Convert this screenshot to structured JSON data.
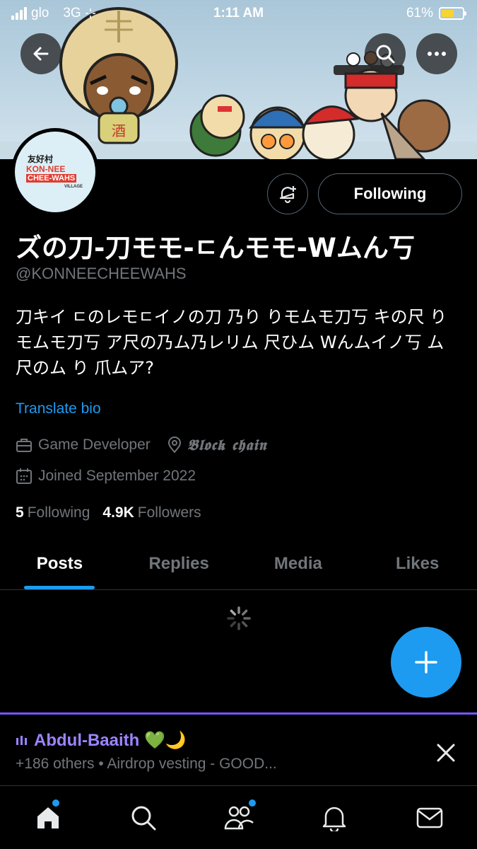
{
  "status_bar": {
    "carrier": "glo",
    "network": "3G",
    "time": "1:11 AM",
    "battery": "61%",
    "battery_level": 0.61
  },
  "header": {
    "display_name": "ズの刀-刀モモ-ㄷんモモ-Wムん丂",
    "handle": "@KONNEECHEEWAHS",
    "follow_label": "Following",
    "avatar_logo": {
      "kanji": "友好村",
      "line1": "KON-NEE",
      "line2": "CHEE-WAHS",
      "line3": "VILLAGE"
    }
  },
  "bio": {
    "text": "刀キイ ㄷのレモㄷイノの刀 乃り りモムモ刀丂 キの尺 りモムモ刀丂 ア尺の乃ム乃レリム 尺ひム Wんムイノ丂 ム 尺のム り 爪ムア?",
    "translate_label": "Translate bio"
  },
  "meta": {
    "category": "Game Developer",
    "location": "𝕭𝖑𝖔𝖈𝖐 𝖈𝖍𝖆𝖎𝖓",
    "joined": "Joined September 2022"
  },
  "stats": {
    "following_count": "5",
    "following_label": "Following",
    "followers_count": "4.9K",
    "followers_label": "Followers"
  },
  "tabs": [
    {
      "label": "Posts"
    },
    {
      "label": "Replies"
    },
    {
      "label": "Media"
    },
    {
      "label": "Likes"
    }
  ],
  "space": {
    "host": "Abdul-Baaith 💚🌙",
    "subtitle": "+186 others • Airdrop vesting - GOOD..."
  },
  "icons": [
    "back-arrow-icon",
    "search-icon",
    "more-icon",
    "bell-plus-icon",
    "briefcase-icon",
    "location-pin-icon",
    "calendar-icon",
    "spinner-icon",
    "plus-icon",
    "close-icon",
    "home-icon",
    "explore-icon",
    "communities-icon",
    "notifications-icon",
    "messages-icon"
  ],
  "colors": {
    "accent": "#1d9bf0",
    "space_purple": "#7856ff",
    "muted": "#71767b"
  }
}
